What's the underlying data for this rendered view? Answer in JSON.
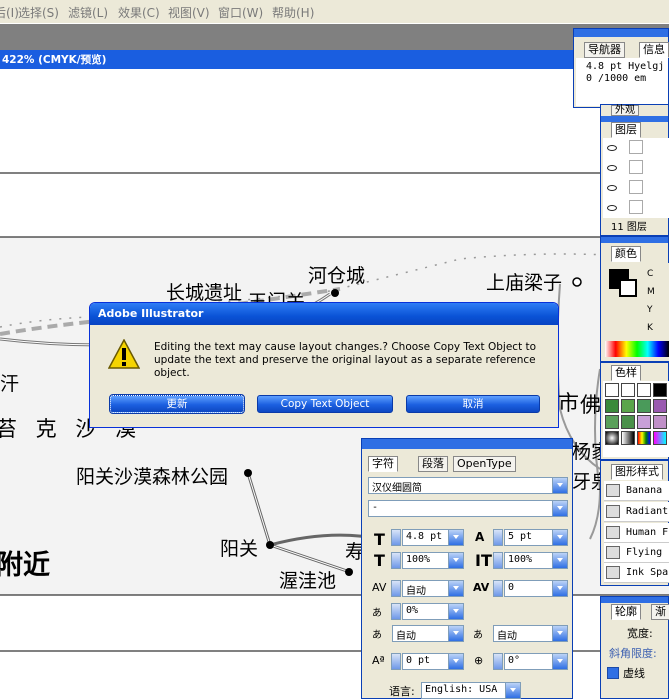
{
  "menubar": {
    "items": [
      "后(I)",
      "选择(S)",
      "滤镜(L)",
      "效果(C)",
      "视图(V)",
      "窗口(W)",
      "帮助(H)"
    ]
  },
  "document": {
    "title": "422% (CMYK/预览)"
  },
  "map": {
    "labels": {
      "hecangcheng": "河仓城",
      "changcheng": "长城遗址",
      "yumenguan": "玉门关",
      "shangmiao": "上庙梁子",
      "dake": "苔 克 沙 漠",
      "yangguan_park": "阳关沙漠森林公园",
      "yangguan": "阳关",
      "wowachi": "渥洼池",
      "shou": "寿",
      "fujin": "附近",
      "shi": "市",
      "fo": "佛",
      "yangjia": "杨家",
      "yaquan": "牙泉",
      "han": "汗"
    }
  },
  "dialog": {
    "title": "Adobe Illustrator",
    "message": "Editing the text may cause layout changes.? Choose Copy Text Object to update the text and preserve the original layout as a separate reference object.",
    "buttons": {
      "update": "更新",
      "copy": "Copy Text Object",
      "cancel": "取消"
    }
  },
  "navigator": {
    "tabs": [
      "导航器",
      "信息"
    ],
    "line1": "4.8 pt Hyelgj",
    "line2": "0 /1000 em"
  },
  "layers": {
    "tabs": [
      "外观",
      "图层"
    ],
    "count_label": "11 图层"
  },
  "color": {
    "tab": "颜色",
    "channels": [
      "C",
      "M",
      "Y",
      "K"
    ]
  },
  "swatches": {
    "tab": "色样"
  },
  "graphic_styles": {
    "tab": "图形样式",
    "items": [
      "Banana",
      "Radiant",
      "Human F",
      "Flying",
      "Ink Spa"
    ]
  },
  "stroke": {
    "tabs": [
      "轮廓",
      "渐"
    ],
    "weight_label": "宽度:",
    "miter_label": "斜角限度:",
    "dashed_label": "虚线"
  },
  "character": {
    "tabs": [
      "字符",
      "段落",
      "OpenType"
    ],
    "font_family": "汉仪细圆简",
    "font_style": "-",
    "font_size": "4.8 pt",
    "leading": "5 pt",
    "h_scale": "100%",
    "v_scale": "100%",
    "kerning": "自动",
    "tracking": "0",
    "tsume": "0%",
    "aki_left": "自动",
    "aki_right": "自动",
    "baseline": "0 pt",
    "rotation": "0°",
    "language_label": "语言:",
    "language": "English: USA"
  }
}
